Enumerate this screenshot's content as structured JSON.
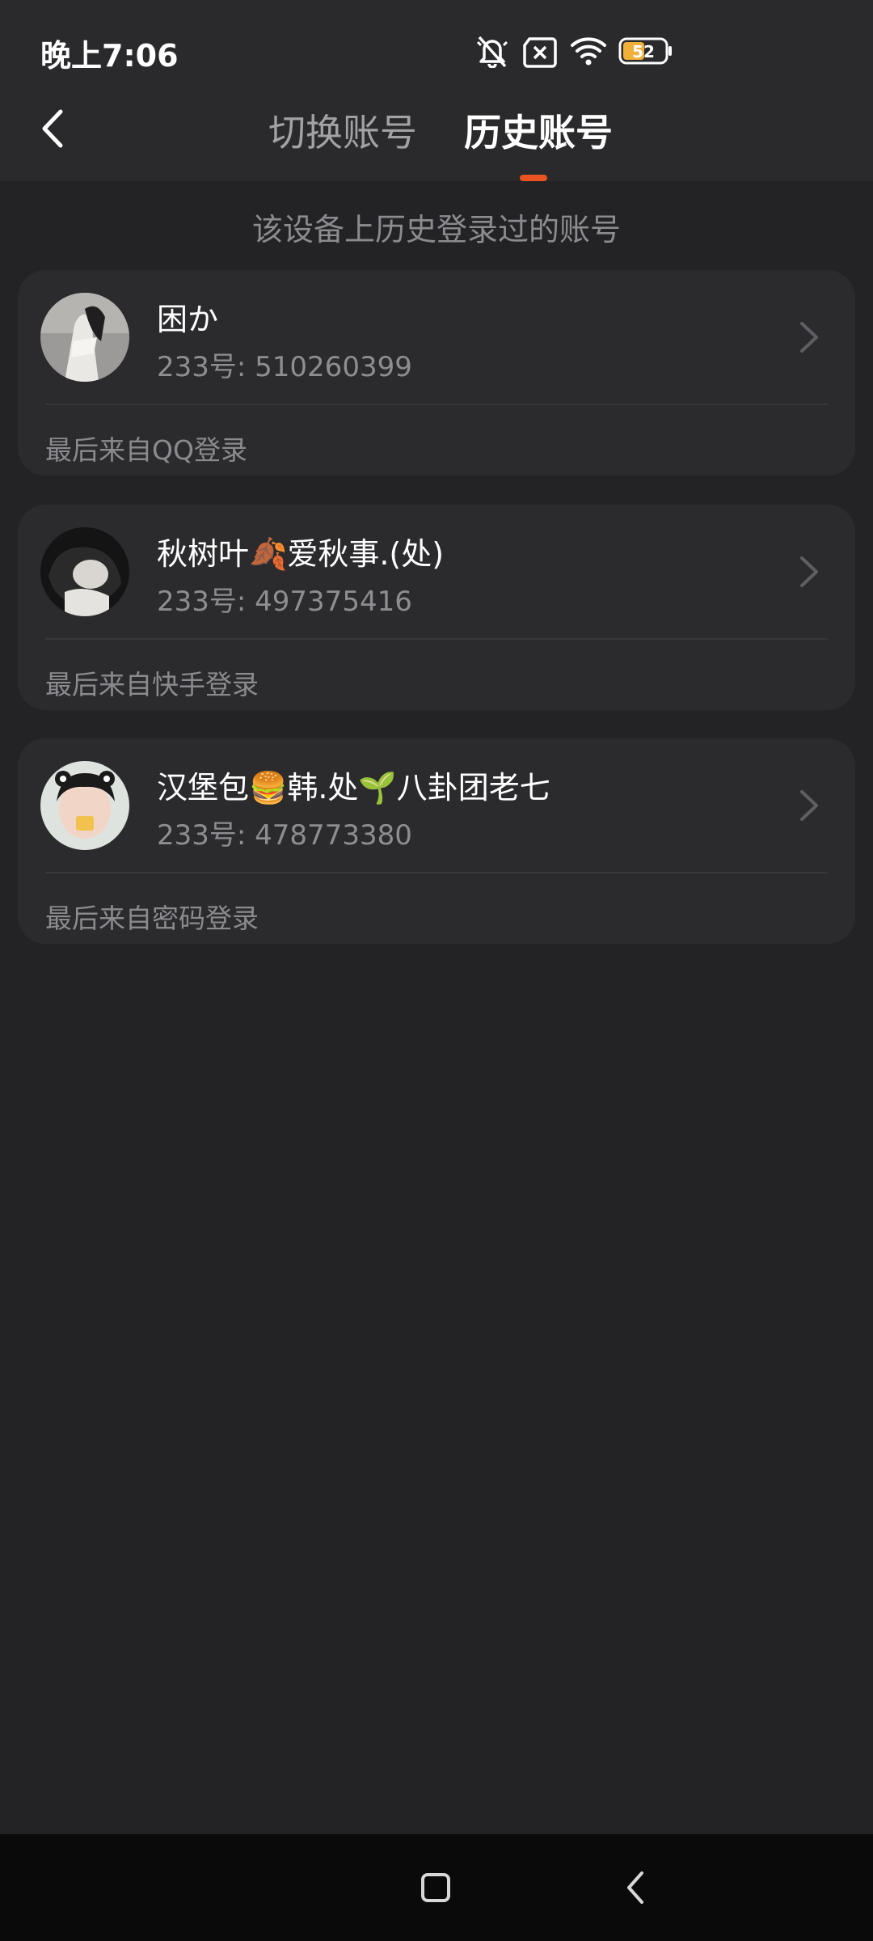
{
  "status_bar": {
    "time": "晚上7:06",
    "battery_level": "52",
    "icons": [
      "bell-muted-icon",
      "sim-x-icon",
      "wifi-icon",
      "battery-icon"
    ]
  },
  "header": {
    "back_icon": "chevron-left-icon",
    "tabs": [
      {
        "label": "切换账号",
        "active": false
      },
      {
        "label": "历史账号",
        "active": true
      }
    ],
    "active_indicator_color": "#e8531f"
  },
  "subtitle": "该设备上历史登录过的账号",
  "accounts": [
    {
      "name": "困か",
      "id_text": "233号: 510260399",
      "login_source": "最后来自QQ登录",
      "avatar": "avatar-photo"
    },
    {
      "name": "秋树叶🍂爱秋事.(处)",
      "id_text": "233号: 497375416",
      "login_source": "最后来自快手登录",
      "avatar": "avatar-photo"
    },
    {
      "name": "汉堡包🍔韩.处🌱八卦团老七",
      "id_text": "233号: 478773380",
      "login_source": "最后来自密码登录",
      "avatar": "avatar-photo"
    }
  ],
  "nav_bar": {
    "icons": [
      "home-square-icon",
      "back-triangle-icon"
    ]
  },
  "colors": {
    "background": "#232225",
    "card": "#2b2b2e",
    "accent": "#e8531f",
    "battery_fill": "#f0b03a"
  }
}
